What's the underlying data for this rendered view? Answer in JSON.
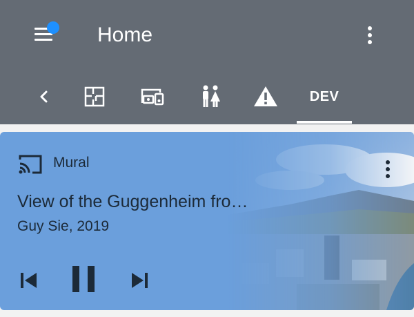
{
  "header": {
    "title": "Home",
    "notification_dot_color": "#1e90ff",
    "menu_icon": "menu-icon",
    "overflow_icon": "more-vert-icon"
  },
  "tabs": [
    {
      "id": "back",
      "icon": "chevron-left-icon"
    },
    {
      "id": "floorplan",
      "icon": "floorplan-icon"
    },
    {
      "id": "devices",
      "icon": "devices-icon"
    },
    {
      "id": "people",
      "icon": "people-icon"
    },
    {
      "id": "alerts",
      "icon": "warning-icon"
    },
    {
      "id": "dev",
      "label": "DEV",
      "selected": true
    }
  ],
  "media_card": {
    "app_name": "Mural",
    "title": "View of the Guggenheim fro…",
    "artist": "Guy Sie, 2019",
    "state": "playing",
    "background_color": "#6b9fdc",
    "controls": [
      "previous-track-icon",
      "pause-icon",
      "next-track-icon"
    ]
  },
  "colors": {
    "app_bar": "#646b74",
    "page_background": "#f2f2f2",
    "card_text": "#1c2a38"
  }
}
